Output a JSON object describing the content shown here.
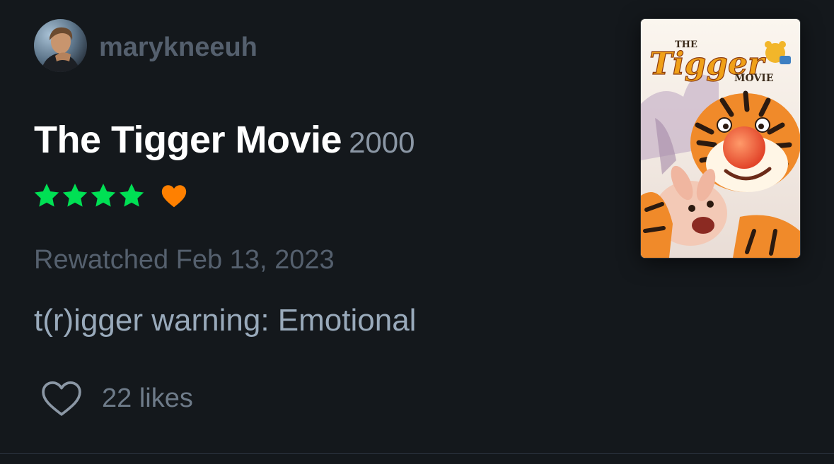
{
  "review": {
    "username": "marykneeuh",
    "film_title": "The Tigger Movie",
    "film_year": "2000",
    "rating_stars": 4,
    "liked": true,
    "watch_date": "Rewatched Feb 13, 2023",
    "text": "t(r)igger warning: Emotional",
    "likes_label": "22 likes"
  },
  "poster": {
    "title_small": "THE",
    "title_big": "Tigger",
    "title_sub": "MOVIE"
  },
  "colors": {
    "background": "#14181c",
    "star": "#00e054",
    "heart": "#ff8000",
    "muted_text": "#55606e",
    "body_text": "#99aabb"
  },
  "icons": {
    "star": "star-icon",
    "liked": "heart-icon",
    "like_button": "heart-outline-icon"
  }
}
